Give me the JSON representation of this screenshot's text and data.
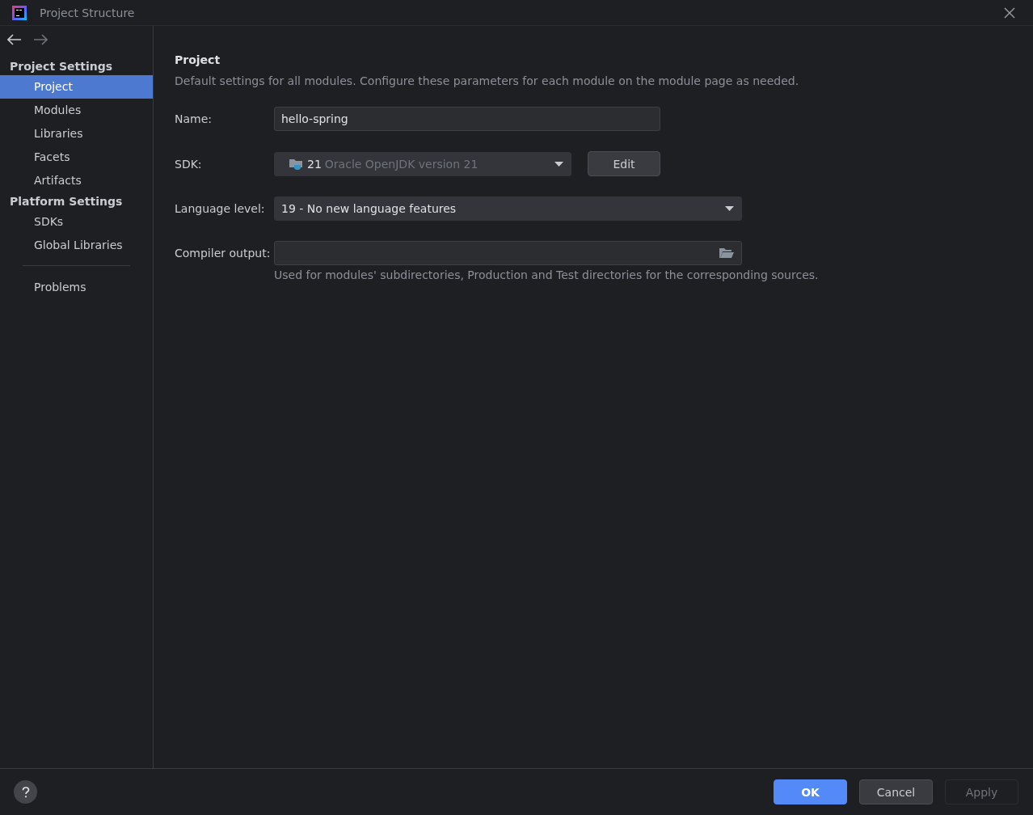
{
  "window": {
    "title": "Project Structure"
  },
  "navigation": {
    "back_enabled": true,
    "forward_enabled": false
  },
  "sidebar": {
    "sections": [
      {
        "title": "Project Settings",
        "items": [
          {
            "label": "Project",
            "selected": true
          },
          {
            "label": "Modules",
            "selected": false
          },
          {
            "label": "Libraries",
            "selected": false
          },
          {
            "label": "Facets",
            "selected": false
          },
          {
            "label": "Artifacts",
            "selected": false
          }
        ]
      },
      {
        "title": "Platform Settings",
        "items": [
          {
            "label": "SDKs",
            "selected": false
          },
          {
            "label": "Global Libraries",
            "selected": false
          }
        ]
      }
    ],
    "extra_items": [
      {
        "label": "Problems",
        "selected": false
      }
    ]
  },
  "content": {
    "heading": "Project",
    "description": "Default settings for all modules. Configure these parameters for each module on the module page as needed.",
    "fields": [
      {
        "kind": "text",
        "label": "Name:",
        "value": "hello-spring"
      },
      {
        "kind": "sdk",
        "label": "SDK:",
        "version": "21",
        "value": "Oracle OpenJDK version 21",
        "button": "Edit"
      },
      {
        "kind": "dropdown",
        "label": "Language level:",
        "value": "19 - No new language features"
      },
      {
        "kind": "path",
        "label": "Compiler output:",
        "hint": "Used for modules' subdirectories, Production and Test directories for the corresponding sources."
      }
    ]
  },
  "footer": {
    "buttons": [
      {
        "kind": "primary",
        "label": "OK",
        "disabled": false
      },
      {
        "kind": "normal",
        "label": "Cancel",
        "disabled": false
      },
      {
        "kind": "normal",
        "label": "Apply",
        "disabled": true
      }
    ]
  }
}
